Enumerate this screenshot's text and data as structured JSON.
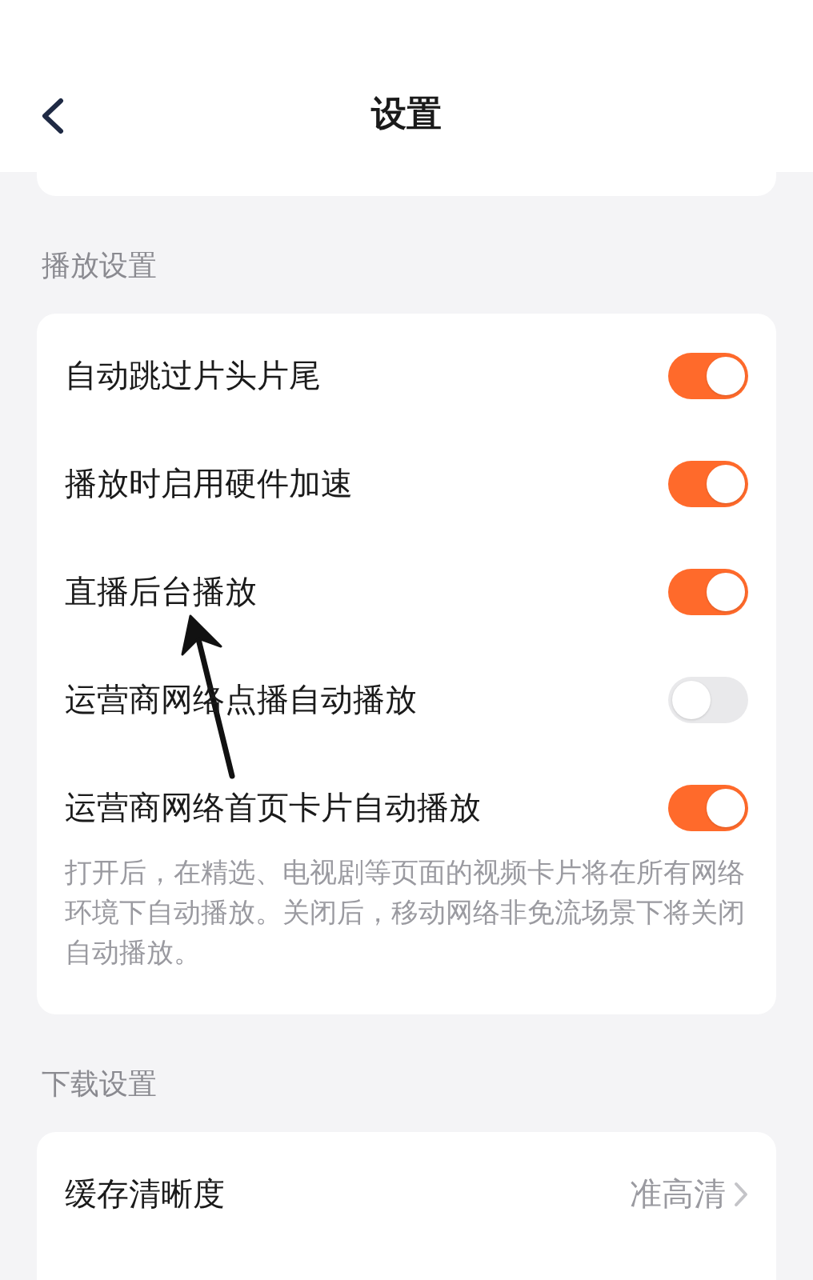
{
  "header": {
    "title": "设置"
  },
  "sections": [
    {
      "title": "播放设置",
      "settings": [
        {
          "label": "自动跳过片头片尾",
          "on": true
        },
        {
          "label": "播放时启用硬件加速",
          "on": true
        },
        {
          "label": "直播后台播放",
          "on": true
        },
        {
          "label": "运营商网络点播自动播放",
          "on": false
        },
        {
          "label": "运营商网络首页卡片自动播放",
          "on": true
        }
      ],
      "note": "打开后，在精选、电视剧等页面的视频卡片将在所有网络环境下自动播放。关闭后，移动网络非免流场景下将关闭自动播放。"
    },
    {
      "title": "下载设置",
      "options": [
        {
          "label": "缓存清晰度",
          "value": "准高清"
        }
      ]
    }
  ]
}
